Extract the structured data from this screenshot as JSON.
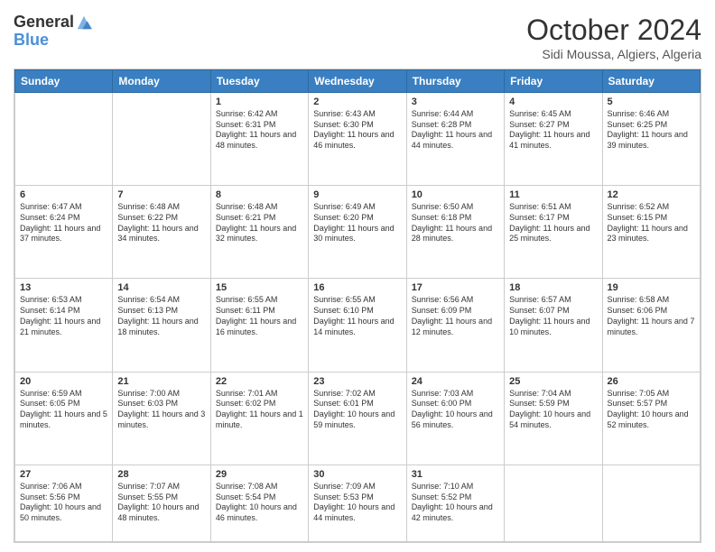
{
  "header": {
    "logo_line1": "General",
    "logo_line2": "Blue",
    "month_title": "October 2024",
    "location": "Sidi Moussa, Algiers, Algeria"
  },
  "days_of_week": [
    "Sunday",
    "Monday",
    "Tuesday",
    "Wednesday",
    "Thursday",
    "Friday",
    "Saturday"
  ],
  "weeks": [
    [
      {
        "day": "",
        "content": ""
      },
      {
        "day": "",
        "content": ""
      },
      {
        "day": "1",
        "content": "Sunrise: 6:42 AM\nSunset: 6:31 PM\nDaylight: 11 hours and 48 minutes."
      },
      {
        "day": "2",
        "content": "Sunrise: 6:43 AM\nSunset: 6:30 PM\nDaylight: 11 hours and 46 minutes."
      },
      {
        "day": "3",
        "content": "Sunrise: 6:44 AM\nSunset: 6:28 PM\nDaylight: 11 hours and 44 minutes."
      },
      {
        "day": "4",
        "content": "Sunrise: 6:45 AM\nSunset: 6:27 PM\nDaylight: 11 hours and 41 minutes."
      },
      {
        "day": "5",
        "content": "Sunrise: 6:46 AM\nSunset: 6:25 PM\nDaylight: 11 hours and 39 minutes."
      }
    ],
    [
      {
        "day": "6",
        "content": "Sunrise: 6:47 AM\nSunset: 6:24 PM\nDaylight: 11 hours and 37 minutes."
      },
      {
        "day": "7",
        "content": "Sunrise: 6:48 AM\nSunset: 6:22 PM\nDaylight: 11 hours and 34 minutes."
      },
      {
        "day": "8",
        "content": "Sunrise: 6:48 AM\nSunset: 6:21 PM\nDaylight: 11 hours and 32 minutes."
      },
      {
        "day": "9",
        "content": "Sunrise: 6:49 AM\nSunset: 6:20 PM\nDaylight: 11 hours and 30 minutes."
      },
      {
        "day": "10",
        "content": "Sunrise: 6:50 AM\nSunset: 6:18 PM\nDaylight: 11 hours and 28 minutes."
      },
      {
        "day": "11",
        "content": "Sunrise: 6:51 AM\nSunset: 6:17 PM\nDaylight: 11 hours and 25 minutes."
      },
      {
        "day": "12",
        "content": "Sunrise: 6:52 AM\nSunset: 6:15 PM\nDaylight: 11 hours and 23 minutes."
      }
    ],
    [
      {
        "day": "13",
        "content": "Sunrise: 6:53 AM\nSunset: 6:14 PM\nDaylight: 11 hours and 21 minutes."
      },
      {
        "day": "14",
        "content": "Sunrise: 6:54 AM\nSunset: 6:13 PM\nDaylight: 11 hours and 18 minutes."
      },
      {
        "day": "15",
        "content": "Sunrise: 6:55 AM\nSunset: 6:11 PM\nDaylight: 11 hours and 16 minutes."
      },
      {
        "day": "16",
        "content": "Sunrise: 6:55 AM\nSunset: 6:10 PM\nDaylight: 11 hours and 14 minutes."
      },
      {
        "day": "17",
        "content": "Sunrise: 6:56 AM\nSunset: 6:09 PM\nDaylight: 11 hours and 12 minutes."
      },
      {
        "day": "18",
        "content": "Sunrise: 6:57 AM\nSunset: 6:07 PM\nDaylight: 11 hours and 10 minutes."
      },
      {
        "day": "19",
        "content": "Sunrise: 6:58 AM\nSunset: 6:06 PM\nDaylight: 11 hours and 7 minutes."
      }
    ],
    [
      {
        "day": "20",
        "content": "Sunrise: 6:59 AM\nSunset: 6:05 PM\nDaylight: 11 hours and 5 minutes."
      },
      {
        "day": "21",
        "content": "Sunrise: 7:00 AM\nSunset: 6:03 PM\nDaylight: 11 hours and 3 minutes."
      },
      {
        "day": "22",
        "content": "Sunrise: 7:01 AM\nSunset: 6:02 PM\nDaylight: 11 hours and 1 minute."
      },
      {
        "day": "23",
        "content": "Sunrise: 7:02 AM\nSunset: 6:01 PM\nDaylight: 10 hours and 59 minutes."
      },
      {
        "day": "24",
        "content": "Sunrise: 7:03 AM\nSunset: 6:00 PM\nDaylight: 10 hours and 56 minutes."
      },
      {
        "day": "25",
        "content": "Sunrise: 7:04 AM\nSunset: 5:59 PM\nDaylight: 10 hours and 54 minutes."
      },
      {
        "day": "26",
        "content": "Sunrise: 7:05 AM\nSunset: 5:57 PM\nDaylight: 10 hours and 52 minutes."
      }
    ],
    [
      {
        "day": "27",
        "content": "Sunrise: 7:06 AM\nSunset: 5:56 PM\nDaylight: 10 hours and 50 minutes."
      },
      {
        "day": "28",
        "content": "Sunrise: 7:07 AM\nSunset: 5:55 PM\nDaylight: 10 hours and 48 minutes."
      },
      {
        "day": "29",
        "content": "Sunrise: 7:08 AM\nSunset: 5:54 PM\nDaylight: 10 hours and 46 minutes."
      },
      {
        "day": "30",
        "content": "Sunrise: 7:09 AM\nSunset: 5:53 PM\nDaylight: 10 hours and 44 minutes."
      },
      {
        "day": "31",
        "content": "Sunrise: 7:10 AM\nSunset: 5:52 PM\nDaylight: 10 hours and 42 minutes."
      },
      {
        "day": "",
        "content": ""
      },
      {
        "day": "",
        "content": ""
      }
    ]
  ]
}
